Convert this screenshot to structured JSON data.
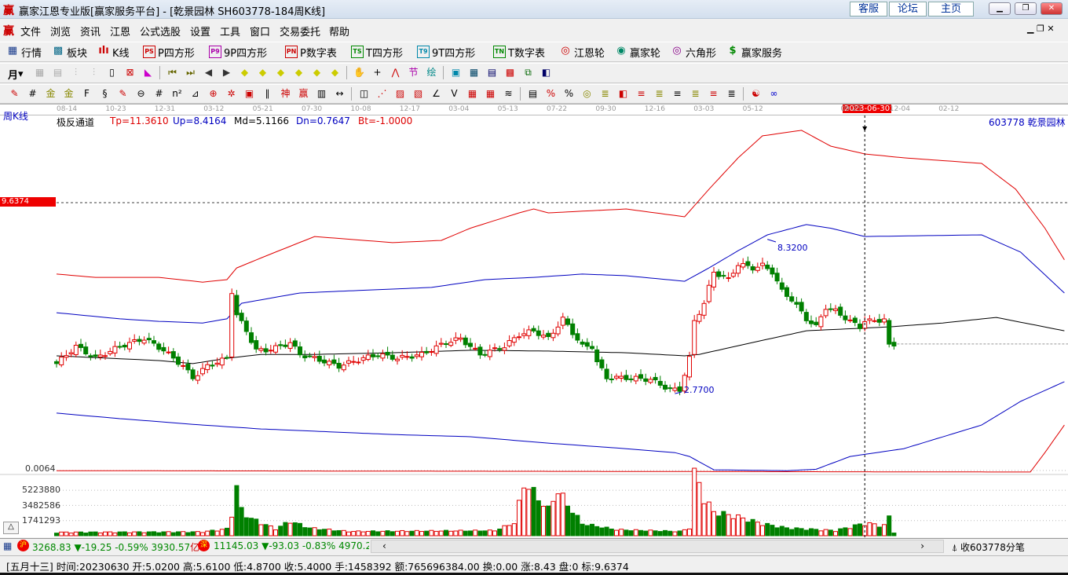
{
  "window": {
    "title": "赢家江恩专业版[赢家服务平台] - [乾景园林  SH603778-184周K线]",
    "logo": "赢",
    "buttons": [
      "客服",
      "论坛",
      "主页"
    ]
  },
  "menu": [
    "文件",
    "浏览",
    "资讯",
    "江恩",
    "公式选股",
    "设置",
    "工具",
    "窗口",
    "交易委托",
    "帮助"
  ],
  "toolbar1": [
    {
      "label": "行情",
      "icon": "grid-table-icon",
      "glyph": "▦",
      "color": "#1a3c8c"
    },
    {
      "label": "板块",
      "icon": "blocks-icon",
      "glyph": "▩",
      "color": "#0a6a8a"
    },
    {
      "label": "K线",
      "icon": "candlestick-icon",
      "glyph": "ılı",
      "color": "#c00"
    },
    {
      "label": "P四方形",
      "icon": "ps-icon",
      "glyph": "PS",
      "color": "#c00"
    },
    {
      "label": "9P四方形",
      "icon": "p9-icon",
      "glyph": "P9",
      "color": "#a0a"
    },
    {
      "label": "P数字表",
      "icon": "pn-icon",
      "glyph": "PN",
      "color": "#c00"
    },
    {
      "label": "T四方形",
      "icon": "ts-icon",
      "glyph": "TS",
      "color": "#080"
    },
    {
      "label": "9T四方形",
      "icon": "t9-icon",
      "glyph": "T9",
      "color": "#08a"
    },
    {
      "label": "T数字表",
      "icon": "tn-icon",
      "glyph": "TN",
      "color": "#080"
    },
    {
      "label": "江恩轮",
      "icon": "gann-wheel-icon",
      "glyph": "◎",
      "color": "#c00"
    },
    {
      "label": "赢家轮",
      "icon": "winner-wheel-icon",
      "glyph": "◉",
      "color": "#086"
    },
    {
      "label": "六角形",
      "icon": "hexagon-icon",
      "glyph": "◎",
      "color": "#808"
    },
    {
      "label": "赢家服务",
      "icon": "dollar-icon",
      "glyph": "$",
      "color": "#080"
    }
  ],
  "period_selector": "月",
  "chart": {
    "period_label": "周K线",
    "indicator": {
      "name": "极反通道",
      "tp": "Tp=11.3610",
      "up": "Up=8.4164",
      "md": "Md=5.1166",
      "dn": "Dn=0.7647",
      "bt": "Bt=-1.0000"
    },
    "stock_label": "603778  乾景园林",
    "cursor_date": "2023-06-30",
    "cursor_price": "9.6374",
    "bottom_price": "0.0064",
    "high_label": "8.3200",
    "low_label": "2.7700",
    "volume_labels": [
      "5223880",
      "3482586",
      "1741293"
    ],
    "date_ticks": [
      "08-14",
      "10-23",
      "12-31",
      "03-12",
      "05-21",
      "07-30",
      "10-08",
      "12-17",
      "03-04",
      "05-13",
      "07-22",
      "09-30",
      "12-16",
      "03-03",
      "05-12",
      "2023-06-30",
      "09-25",
      "12-04",
      "02-12"
    ]
  },
  "chart_data": {
    "type": "candlestick",
    "title": "乾景园林 SH603778 周K线 极反通道",
    "price_range": [
      -0.3,
      12.4
    ],
    "close_keypoints": [
      [
        0,
        3.85
      ],
      [
        4,
        4.47
      ],
      [
        8,
        4.04
      ],
      [
        13,
        4.47
      ],
      [
        18,
        4.75
      ],
      [
        22,
        4.33
      ],
      [
        26,
        3.76
      ],
      [
        28,
        3.34
      ],
      [
        31,
        3.76
      ],
      [
        35,
        4.04
      ],
      [
        36,
        6.45
      ],
      [
        37,
        5.6
      ],
      [
        39,
        5.03
      ],
      [
        41,
        4.33
      ],
      [
        43,
        4.33
      ],
      [
        46,
        4.47
      ],
      [
        48,
        4.61
      ],
      [
        50,
        4.18
      ],
      [
        53,
        4.04
      ],
      [
        58,
        3.76
      ],
      [
        63,
        4.04
      ],
      [
        66,
        4.18
      ],
      [
        70,
        4.04
      ],
      [
        75,
        4.18
      ],
      [
        80,
        4.61
      ],
      [
        83,
        4.75
      ],
      [
        87,
        4.18
      ],
      [
        92,
        4.47
      ],
      [
        95,
        4.89
      ],
      [
        98,
        5.03
      ],
      [
        101,
        4.75
      ],
      [
        104,
        5.46
      ],
      [
        108,
        4.47
      ],
      [
        110,
        4.47
      ],
      [
        111,
        3.9
      ],
      [
        113,
        3.34
      ],
      [
        117,
        3.34
      ],
      [
        122,
        3.28
      ],
      [
        126,
        2.91
      ],
      [
        128,
        2.91
      ],
      [
        130,
        4.04
      ],
      [
        131,
        5.37
      ],
      [
        133,
        6.02
      ],
      [
        135,
        7.15
      ],
      [
        138,
        6.87
      ],
      [
        140,
        7.43
      ],
      [
        143,
        7.29
      ],
      [
        145,
        7.38
      ],
      [
        147,
        7.15
      ],
      [
        149,
        6.45
      ],
      [
        151,
        6.16
      ],
      [
        154,
        5.46
      ],
      [
        156,
        5.17
      ],
      [
        158,
        5.88
      ],
      [
        160,
        5.74
      ],
      [
        163,
        5.37
      ],
      [
        165,
        5.17
      ],
      [
        166,
        5.4
      ],
      [
        168,
        5.37
      ],
      [
        170,
        5.46
      ],
      [
        171,
        4.47
      ],
      [
        172,
        4.5
      ]
    ],
    "candle_count": 173,
    "bands": [
      {
        "name": "Tp",
        "color": "#e00000",
        "points": [
          [
            0,
            7.07
          ],
          [
            8,
            6.95
          ],
          [
            21,
            6.95
          ],
          [
            30,
            6.78
          ],
          [
            35,
            6.87
          ],
          [
            37,
            7.29
          ],
          [
            43,
            7.72
          ],
          [
            53,
            8.42
          ],
          [
            69,
            8.2
          ],
          [
            79,
            8.28
          ],
          [
            85,
            8.72
          ],
          [
            95,
            9.27
          ],
          [
            98,
            9.41
          ],
          [
            101,
            9.27
          ],
          [
            117,
            9.41
          ],
          [
            129,
            9.13
          ],
          [
            134,
            10.12
          ],
          [
            140,
            11.25
          ],
          [
            145,
            12.04
          ],
          [
            153,
            12.24
          ],
          [
            159,
            11.67
          ],
          [
            166,
            11.39
          ],
          [
            174,
            11.25
          ],
          [
            190,
            11.05
          ],
          [
            197,
            10.12
          ],
          [
            203,
            8.72
          ],
          [
            207,
            7.58
          ]
        ]
      },
      {
        "name": "Up",
        "color": "#0000c0",
        "points": [
          [
            0,
            5.68
          ],
          [
            13,
            5.46
          ],
          [
            21,
            5.37
          ],
          [
            30,
            5.31
          ],
          [
            35,
            5.46
          ],
          [
            38,
            6.02
          ],
          [
            50,
            6.39
          ],
          [
            58,
            6.45
          ],
          [
            69,
            6.53
          ],
          [
            77,
            6.59
          ],
          [
            88,
            6.87
          ],
          [
            98,
            6.95
          ],
          [
            108,
            7.07
          ],
          [
            117,
            7.01
          ],
          [
            129,
            6.81
          ],
          [
            134,
            7.29
          ],
          [
            140,
            7.91
          ],
          [
            146,
            8.48
          ],
          [
            154,
            8.85
          ],
          [
            159,
            8.72
          ],
          [
            166,
            8.42
          ],
          [
            190,
            8.48
          ],
          [
            198,
            7.86
          ],
          [
            207,
            6.39
          ]
        ]
      },
      {
        "name": "Md",
        "color": "#000000",
        "points": [
          [
            0,
            4.13
          ],
          [
            21,
            3.96
          ],
          [
            28,
            3.85
          ],
          [
            35,
            4.04
          ],
          [
            42,
            4.18
          ],
          [
            53,
            4.18
          ],
          [
            69,
            4.24
          ],
          [
            85,
            4.33
          ],
          [
            101,
            4.3
          ],
          [
            117,
            4.24
          ],
          [
            129,
            4.13
          ],
          [
            132,
            4.18
          ],
          [
            143,
            4.61
          ],
          [
            154,
            5.03
          ],
          [
            171,
            5.17
          ],
          [
            182,
            5.31
          ],
          [
            193,
            5.51
          ],
          [
            207,
            5.03
          ]
        ]
      },
      {
        "name": "Dn",
        "color": "#0000c0",
        "points": [
          [
            0,
            2.07
          ],
          [
            13,
            1.87
          ],
          [
            30,
            1.64
          ],
          [
            42,
            1.5
          ],
          [
            53,
            1.42
          ],
          [
            69,
            1.3
          ],
          [
            85,
            1.22
          ],
          [
            101,
            0.99
          ],
          [
            117,
            0.79
          ],
          [
            127,
            0.65
          ],
          [
            130,
            0.51
          ],
          [
            135,
            0.03
          ],
          [
            150,
            0.0
          ],
          [
            156,
            0.05
          ],
          [
            163,
            0.51
          ],
          [
            174,
            0.79
          ],
          [
            190,
            1.64
          ],
          [
            198,
            2.49
          ],
          [
            207,
            3.2
          ]
        ]
      },
      {
        "name": "Bt",
        "color": "#e00000",
        "points": [
          [
            0,
            0.0
          ],
          [
            200,
            -0.05
          ],
          [
            203,
            0.65
          ],
          [
            207,
            1.64
          ]
        ]
      }
    ],
    "volume_range": [
      0,
      7200000
    ],
    "volume_keypoints": [
      [
        0,
        400000
      ],
      [
        30,
        450000
      ],
      [
        35,
        800000
      ],
      [
        36,
        2600000
      ],
      [
        37,
        5700000
      ],
      [
        38,
        3000000
      ],
      [
        40,
        2000000
      ],
      [
        45,
        800000
      ],
      [
        48,
        1700000
      ],
      [
        52,
        900000
      ],
      [
        60,
        500000
      ],
      [
        90,
        600000
      ],
      [
        94,
        1500000
      ],
      [
        96,
        5900000
      ],
      [
        97,
        5800000
      ],
      [
        99,
        4300000
      ],
      [
        101,
        3100000
      ],
      [
        103,
        5300000
      ],
      [
        105,
        3600000
      ],
      [
        108,
        1400000
      ],
      [
        115,
        700000
      ],
      [
        128,
        500000
      ],
      [
        130,
        900000
      ],
      [
        131,
        7100000
      ],
      [
        132,
        6200000
      ],
      [
        133,
        4300000
      ],
      [
        135,
        2800000
      ],
      [
        140,
        2200000
      ],
      [
        145,
        1400000
      ],
      [
        150,
        900000
      ],
      [
        160,
        600000
      ],
      [
        166,
        1458392
      ],
      [
        170,
        1200000
      ],
      [
        171,
        2200000
      ],
      [
        172,
        400000
      ]
    ],
    "cursor_index": 166,
    "high_point": {
      "index": 146,
      "value": 8.32
    },
    "low_point": {
      "index": 127,
      "value": 2.77
    }
  },
  "index_bar": {
    "sh_label": "沪",
    "sh": "3268.83",
    "sh_chg": "▼-19.25",
    "sh_pct": "-0.59%",
    "sh_amt": "3930.57",
    "sh_unit": "亿",
    "sz_label": "深",
    "sz": "11145.03",
    "sz_chg": "▼-93.03",
    "sz_pct": "-0.83%",
    "sz_amt": "4970.20",
    "collect": "收603778分笔"
  },
  "status": "[五月十三] 时间:20230630 开:5.0200 高:5.6100 低:4.8700 收:5.4000 手:1458392 额:765696384.00 换:0.00 涨:8.43 盘:0 标:9.6374"
}
